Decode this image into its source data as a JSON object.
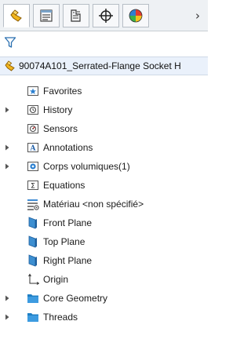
{
  "tabs": [
    {
      "name": "feature-manager-tab",
      "icon": "part-tree-icon",
      "active": true
    },
    {
      "name": "property-manager-tab",
      "icon": "property-sheet-icon",
      "active": false
    },
    {
      "name": "configuration-manager-tab",
      "icon": "configuration-icon",
      "active": false
    },
    {
      "name": "dimxpert-manager-tab",
      "icon": "crosshair-icon",
      "active": false
    },
    {
      "name": "display-manager-tab",
      "icon": "color-wheel-icon",
      "active": false
    }
  ],
  "more_tabs": "›",
  "filter": {
    "icon": "filter-funnel-icon"
  },
  "root": {
    "label": "90074A101_Serrated-Flange Socket H",
    "icon": "part-icon"
  },
  "items": [
    {
      "label": "Favorites",
      "icon": "favorites-folder-icon",
      "expandable": false
    },
    {
      "label": "History",
      "icon": "history-folder-icon",
      "expandable": true
    },
    {
      "label": "Sensors",
      "icon": "sensors-folder-icon",
      "expandable": false
    },
    {
      "label": "Annotations",
      "icon": "annotations-folder-icon",
      "expandable": true
    },
    {
      "label": "Corps volumiques(1)",
      "icon": "solid-bodies-folder-icon",
      "expandable": true
    },
    {
      "label": "Equations",
      "icon": "equations-folder-icon",
      "expandable": false
    },
    {
      "label": "Matériau <non spécifié>",
      "icon": "material-icon",
      "expandable": false
    },
    {
      "label": "Front Plane",
      "icon": "plane-icon",
      "expandable": false
    },
    {
      "label": "Top Plane",
      "icon": "plane-icon",
      "expandable": false
    },
    {
      "label": "Right Plane",
      "icon": "plane-icon",
      "expandable": false
    },
    {
      "label": "Origin",
      "icon": "origin-icon",
      "expandable": false
    },
    {
      "label": "Core Geometry",
      "icon": "folder-icon",
      "expandable": true
    },
    {
      "label": "Threads",
      "icon": "folder-icon",
      "expandable": true
    }
  ],
  "colors": {
    "accent_blue": "#1f7fc4",
    "folder_blue": "#3d8fd1",
    "part_yellow": "#f2b51c",
    "selection_bg": "#eaf1fb"
  }
}
